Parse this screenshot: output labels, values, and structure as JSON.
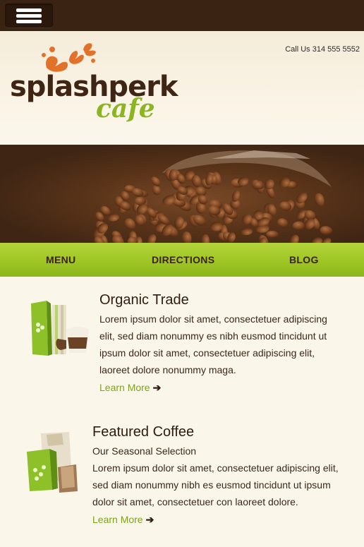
{
  "topbar": {
    "menu_button": "menu-toggle"
  },
  "header": {
    "call_text": "Call Us 314 555 5552",
    "logo_word": "splashperk",
    "logo_sub": "cafe"
  },
  "nav": {
    "items": [
      {
        "label": "MENU"
      },
      {
        "label": "DIRECTIONS"
      },
      {
        "label": "BLOG"
      }
    ]
  },
  "sections": [
    {
      "title": "Organic Trade",
      "lines": [
        "Lorem ipsum dolor sit amet, consectetuer adipiscing",
        "elit, sed diam nonummy es nibh eusmod tincidunt ut",
        "ipsum dolor sit amet, consectetuer adipiscing elit,",
        "laoreet dolore nonummy maga."
      ],
      "link": "Learn More"
    },
    {
      "title": "Featured Coffee",
      "subtitle": "Our Seasonal Selection",
      "lines": [
        "Lorem ipsum dolor sit amet, consectetuer adipiscing elit,",
        "sed diam nonummy nibh es eusmod tincidunt ut ipsum",
        "dolor sit amet, consectetuer con laoreet dolore."
      ],
      "link": "Learn More"
    }
  ],
  "colors": {
    "brown": "#3b2313",
    "green": "#9cc423",
    "orange": "#e2712a",
    "cream": "#fbf6ea"
  }
}
